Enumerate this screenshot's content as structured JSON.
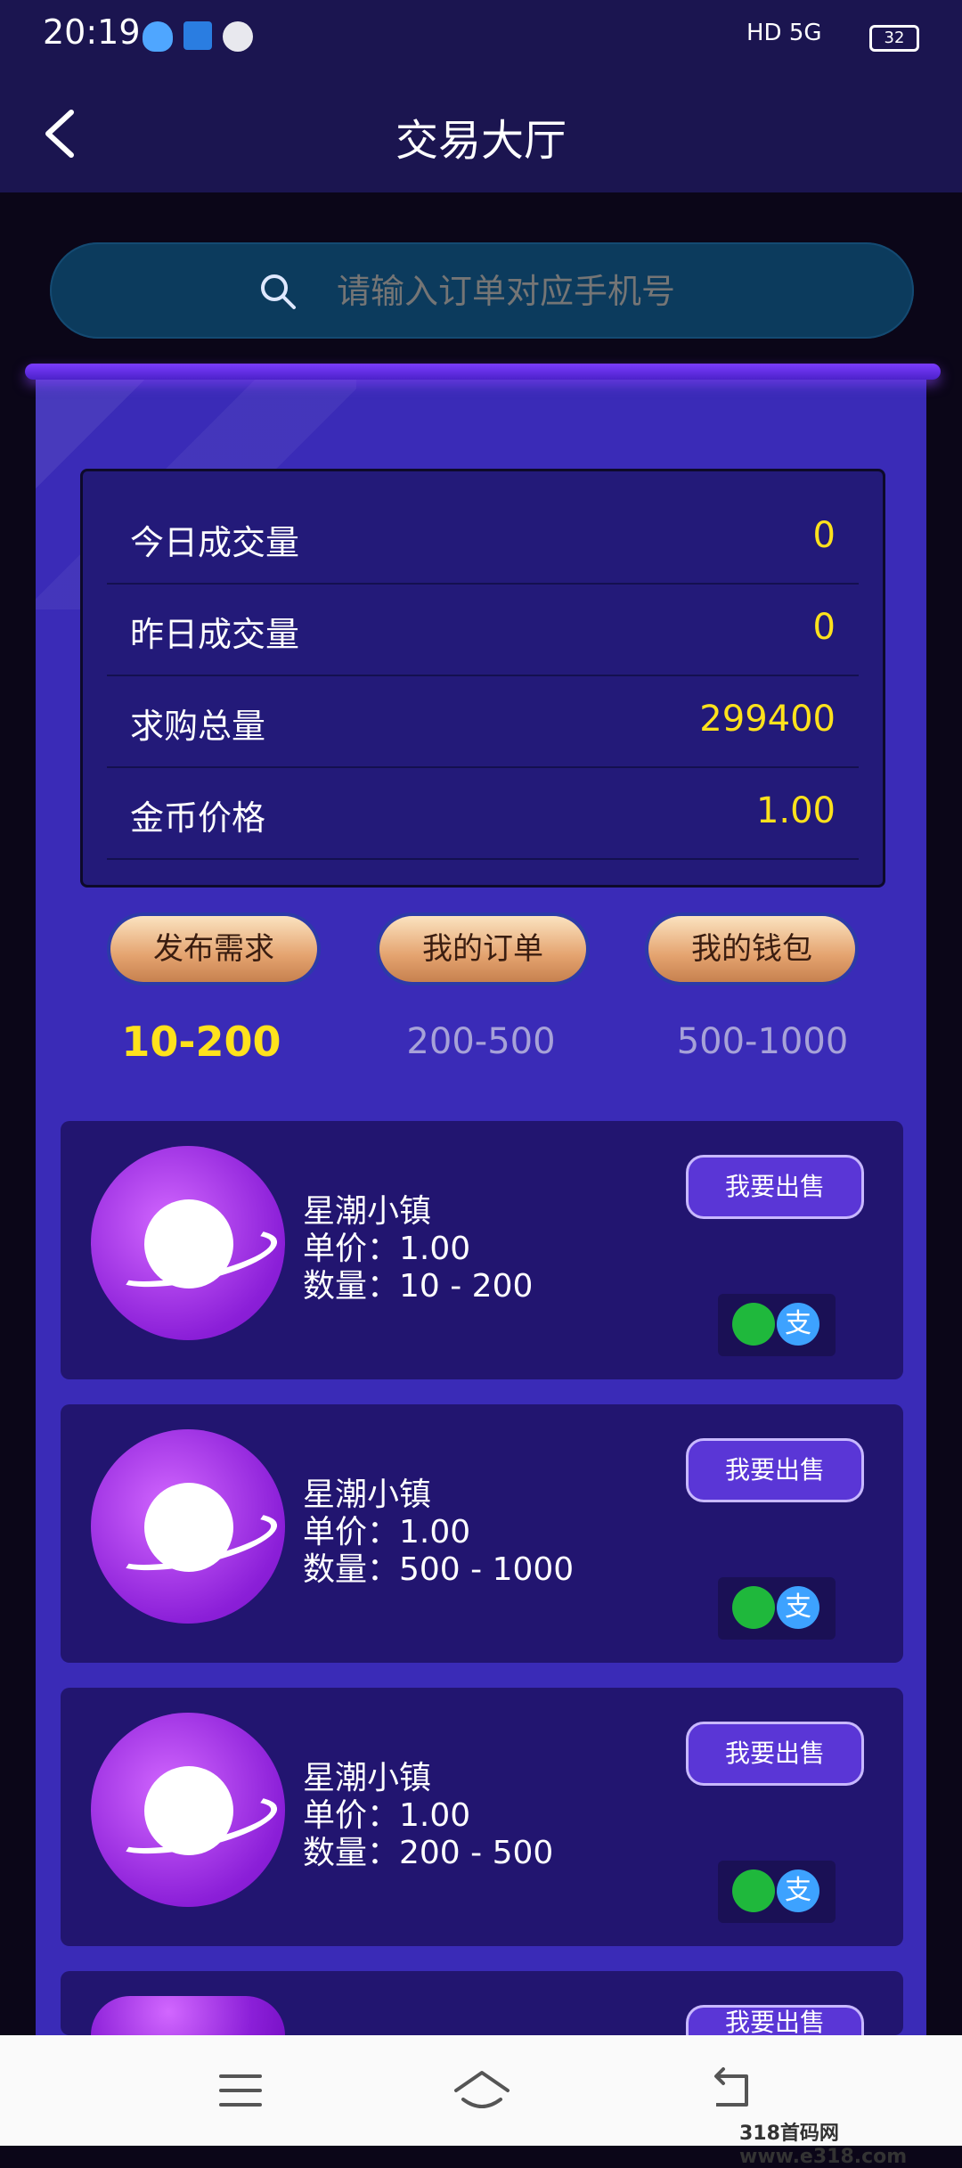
{
  "status_bar": {
    "time": "20:19",
    "right_text": "HD 5G",
    "battery": "32",
    "icons": [
      "qq-icon",
      "news-badge-icon",
      "wechat-icon",
      "alarm-icon",
      "hd-icon",
      "signal-icon",
      "battery-icon"
    ]
  },
  "header": {
    "title": "交易大厅",
    "back_icon": "chevron-left-icon"
  },
  "search": {
    "placeholder": "请输入订单对应手机号",
    "icon": "search-icon"
  },
  "stats": [
    {
      "label": "今日成交量",
      "value": "0"
    },
    {
      "label": "昨日成交量",
      "value": "0"
    },
    {
      "label": "求购总量",
      "value": "299400"
    },
    {
      "label": "金币价格",
      "value": "1.00"
    }
  ],
  "actions": [
    {
      "label": "发布需求"
    },
    {
      "label": "我的订单"
    },
    {
      "label": "我的钱包"
    }
  ],
  "ranges": [
    {
      "label": "10-200",
      "active": true
    },
    {
      "label": "200-500",
      "active": false
    },
    {
      "label": "500-1000",
      "active": false
    }
  ],
  "orders": [
    {
      "name": "星潮小镇",
      "price": "单价：1.00",
      "qty": "数量：10 - 200",
      "sell_label": "我要出售",
      "pay_ali": "支"
    },
    {
      "name": "星潮小镇",
      "price": "单价：1.00",
      "qty": "数量：500 - 1000",
      "sell_label": "我要出售",
      "pay_ali": "支"
    },
    {
      "name": "星潮小镇",
      "price": "单价：1.00",
      "qty": "数量：200 - 500",
      "sell_label": "我要出售",
      "pay_ali": "支"
    },
    {
      "sell_label": "我要出售"
    }
  ],
  "colors": {
    "accent_yellow": "#ffe21c",
    "panel_purple": "#3a2bb7",
    "card_dark": "#221570",
    "search_bg": "#0c3b5d"
  },
  "navbar": {
    "icons": [
      "menu-icon",
      "home-icon",
      "back-icon"
    ]
  },
  "watermark": "318首码网 www.e318.com"
}
